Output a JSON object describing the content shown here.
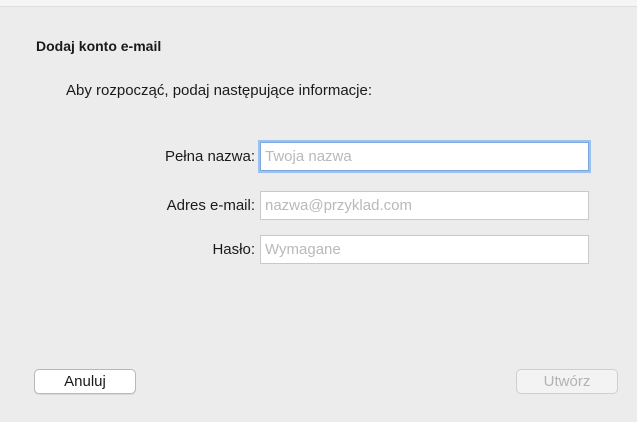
{
  "dialog": {
    "title": "Dodaj konto e-mail",
    "subtitle": "Aby rozpocząć, podaj następujące informacje:"
  },
  "fields": {
    "full_name": {
      "label": "Pełna nazwa:",
      "placeholder": "Twoja nazwa",
      "value": ""
    },
    "email": {
      "label": "Adres e-mail:",
      "placeholder": "nazwa@przyklad.com",
      "value": ""
    },
    "password": {
      "label": "Hasło:",
      "placeholder": "Wymagane",
      "value": ""
    }
  },
  "buttons": {
    "cancel_label": "Anuluj",
    "create_label": "Utwórz"
  },
  "colors": {
    "background": "#ececec",
    "focus_ring": "#9cc0f0",
    "disabled_text": "#b3b3b3"
  }
}
